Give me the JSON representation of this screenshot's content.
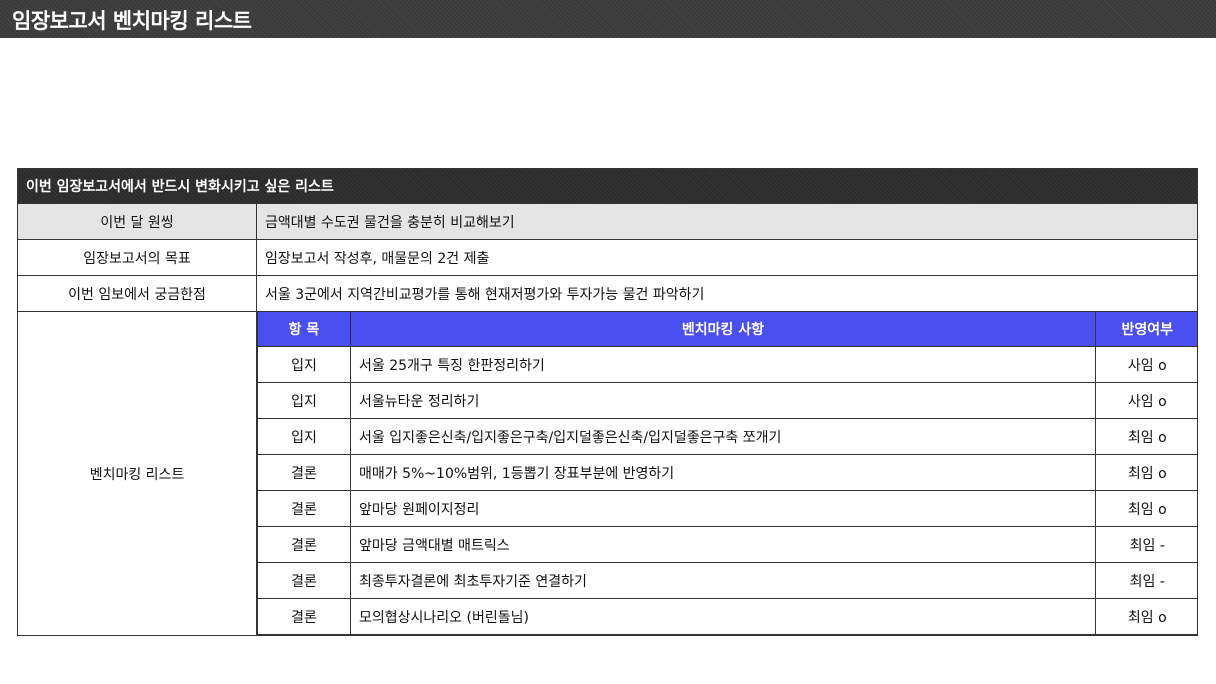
{
  "header": {
    "title": "임장보고서 벤치마킹 리스트"
  },
  "table": {
    "banner": "이번 임장보고서에서 반드시 변화시키고 싶은 리스트",
    "rows": [
      {
        "label": "이번 달 원씽",
        "value": "금액대별 수도권 물건을 충분히 비교해보기"
      },
      {
        "label": "임장보고서의 목표",
        "value": "임장보고서 작성후, 매물문의 2건 제출"
      },
      {
        "label": "이번 임보에서 궁금한점",
        "value": "서울 3군에서 지역간비교평가를 통해 현재저평가와 투자가능 물건 파악하기"
      }
    ],
    "benchmark": {
      "label": "벤치마킹 리스트",
      "columns": [
        "항 목",
        "벤치마킹 사항",
        "반영여부"
      ],
      "rows": [
        {
          "category": "입지",
          "item": "서울 25개구 특징 한판정리하기",
          "status": "사임 o"
        },
        {
          "category": "입지",
          "item": "서울뉴타운 정리하기",
          "status": "사임 o"
        },
        {
          "category": "입지",
          "item": "서울 입지좋은신축/입지좋은구축/입지덜좋은신축/입지덜좋은구축 쪼개기",
          "status": "최임 o"
        },
        {
          "category": "결론",
          "item": "매매가 5%~10%범위, 1등뽑기 장표부분에 반영하기",
          "status": "최임 o"
        },
        {
          "category": "결론",
          "item": "앞마당 원페이지정리",
          "status": "최임 o"
        },
        {
          "category": "결론",
          "item": "앞마당 금액대별 매트릭스",
          "status": "최임 -"
        },
        {
          "category": "결론",
          "item": "최종투자결론에 최초투자기준 연결하기",
          "status": "최임 -"
        },
        {
          "category": "결론",
          "item": "모의협상시나리오 (버린돌님)",
          "status": "최임 o"
        }
      ]
    }
  },
  "colors": {
    "banner_bg": "#2b2b2b",
    "header_bg": "#3a3a3a",
    "benchmark_header_bg": "#4b4ef0",
    "highlight_row_bg": "#e4e4e4"
  }
}
